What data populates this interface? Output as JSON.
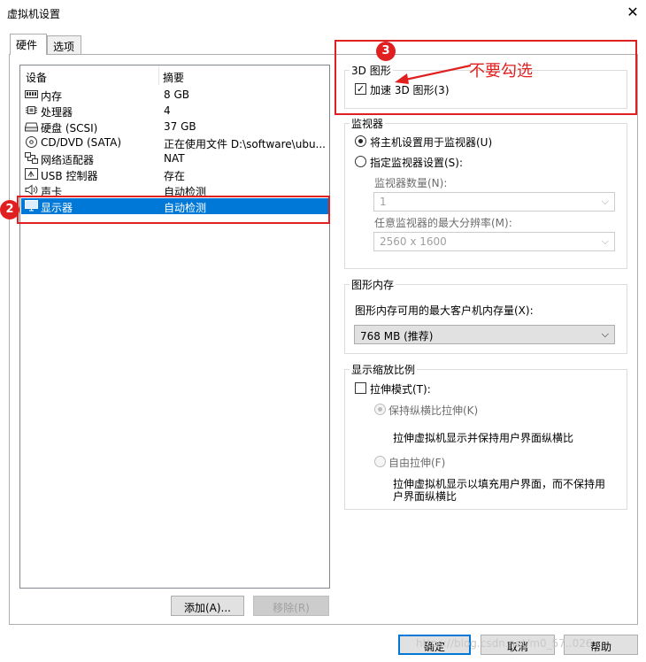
{
  "window": {
    "title": "虚拟机设置",
    "close_glyph": "✕"
  },
  "tabs": [
    {
      "label": "硬件"
    },
    {
      "label": "选项"
    }
  ],
  "device_list": {
    "headers": {
      "device": "设备",
      "summary": "摘要"
    },
    "rows": [
      {
        "name": "内存",
        "summary": "8 GB",
        "icon": "memory-icon"
      },
      {
        "name": "处理器",
        "summary": "4",
        "icon": "processor-icon"
      },
      {
        "name": "硬盘 (SCSI)",
        "summary": "37 GB",
        "icon": "hard-disk-icon"
      },
      {
        "name": "CD/DVD (SATA)",
        "summary": "正在使用文件 D:\\software\\ubu...",
        "icon": "cd-dvd-icon"
      },
      {
        "name": "网络适配器",
        "summary": "NAT",
        "icon": "network-adapter-icon"
      },
      {
        "name": "USB 控制器",
        "summary": "存在",
        "icon": "usb-icon"
      },
      {
        "name": "声卡",
        "summary": "自动检测",
        "icon": "speaker-icon"
      },
      {
        "name": "显示器",
        "summary": "自动检测",
        "icon": "monitor-icon",
        "selected": true
      }
    ]
  },
  "buttons": {
    "add": "添加(A)...",
    "remove": "移除(R)",
    "ok": "确定",
    "cancel": "取消",
    "help": "帮助"
  },
  "graphics_3d": {
    "title": "3D 图形",
    "accelerate_label": "加速 3D 图形(3)",
    "accelerate_checked": true
  },
  "monitor": {
    "title": "监视器",
    "use_host_label": "将主机设置用于监视器(U)",
    "specify_label": "指定监视器设置(S):",
    "count_label": "监视器数量(N):",
    "count_value": "1",
    "max_res_label": "任意监视器的最大分辨率(M):",
    "max_res_value": "2560 x 1600"
  },
  "graphics_memory": {
    "title": "图形内存",
    "label": "图形内存可用的最大客户机内存量(X):",
    "value": "768 MB (推荐)"
  },
  "scaling": {
    "title": "显示缩放比例",
    "stretch_label": "拉伸模式(T):",
    "keep_aspect_label": "保持纵横比拉伸(K)",
    "keep_aspect_desc": "拉伸虚拟机显示并保持用户界面纵横比",
    "free_label": "自由拉伸(F)",
    "free_desc_line1": "拉伸虚拟机显示以填充用户界面，而不保持用",
    "free_desc_line2": "户界面纵横比"
  },
  "annotations": {
    "badge2": "2",
    "badge3": "3",
    "note": "不要勾选",
    "color": "#e02020"
  },
  "watermark": "https://blog.csdn.net/m0_57..026"
}
